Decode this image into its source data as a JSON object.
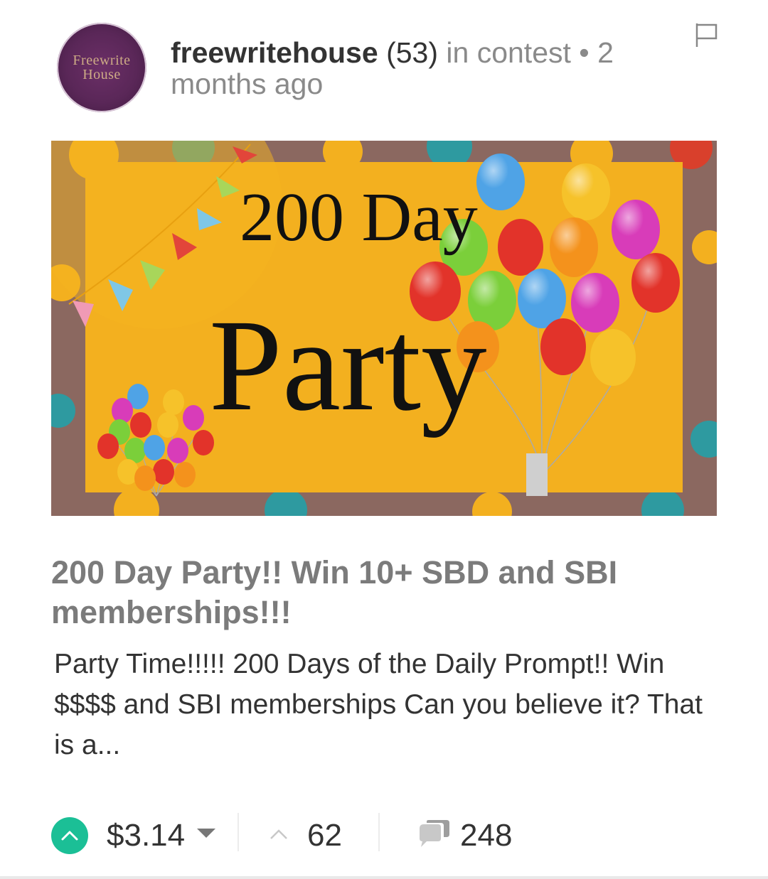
{
  "post": {
    "author": "freewritehouse",
    "reputation": "(53)",
    "context": "in contest",
    "separator": "•",
    "time": "2 months ago",
    "avatar_text_line1": "Freewrite",
    "avatar_text_line2": "House",
    "image_line1": "200 Day",
    "image_line2": "Party",
    "title": "200 Day Party!! Win 10+ SBD and SBI memberships!!!",
    "excerpt": "Party Time!!!!! 200 Days of the Daily Prompt!! Win $$$$ and SBI memberships Can you believe it? That is a..."
  },
  "footer": {
    "payout": "$3.14",
    "votes": "62",
    "comments": "248"
  },
  "colors": {
    "accent": "#1bbf96",
    "banner_bg": "#f3b01f",
    "avatar_bg": "#5a2758"
  },
  "icons": [
    "flag-icon",
    "upvote-icon",
    "dropdown-caret-icon",
    "upvote-count-icon",
    "comments-icon"
  ]
}
